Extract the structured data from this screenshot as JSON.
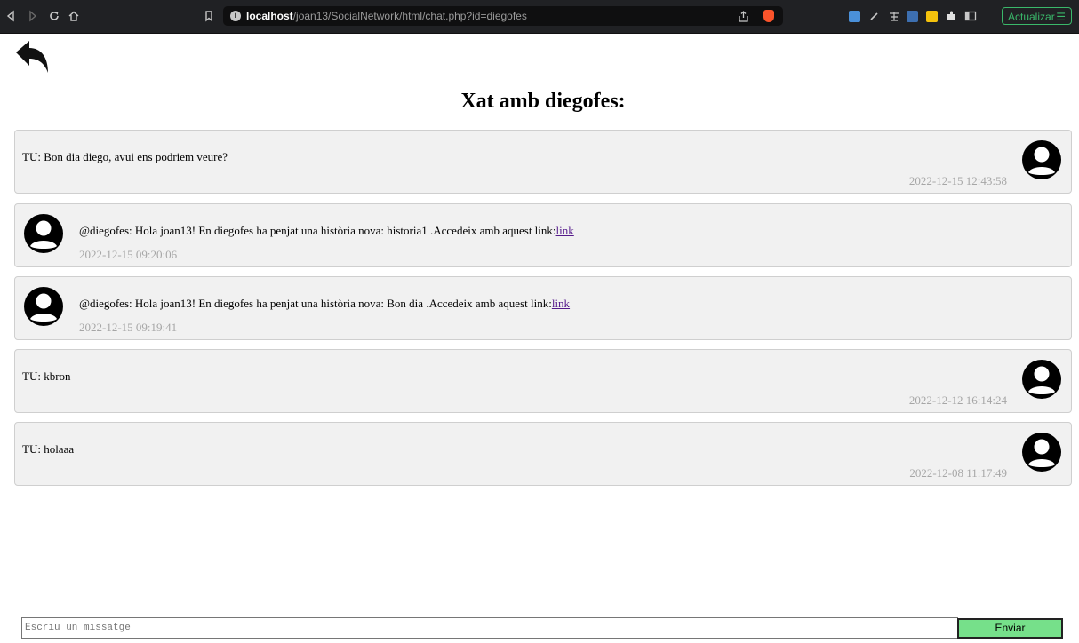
{
  "browser": {
    "url_host": "localhost",
    "url_path": "/joan13/SocialNetwork/html/chat.php?id=diegofes",
    "update_label": "Actualizar"
  },
  "page": {
    "title": "Xat amb diegofes:"
  },
  "messages": [
    {
      "side": "mine",
      "text": "TU: Bon dia diego, avui ens podriem veure?",
      "time": "2022-12-15 12:43:58"
    },
    {
      "side": "theirs",
      "text": "@diegofes: Hola joan13! En diegofes ha penjat una història nova: historia1 .Accedeix amb aquest link:",
      "link": "link",
      "time": "2022-12-15 09:20:06"
    },
    {
      "side": "theirs",
      "text": "@diegofes: Hola joan13! En diegofes ha penjat una història nova: Bon dia .Accedeix amb aquest link:",
      "link": "link",
      "time": "2022-12-15 09:19:41"
    },
    {
      "side": "mine",
      "text": "TU: kbron",
      "time": "2022-12-12 16:14:24"
    },
    {
      "side": "mine",
      "text": "TU: holaaa",
      "time": "2022-12-08 11:17:49"
    }
  ],
  "composer": {
    "placeholder": "Escriu un missatge",
    "send_label": "Enviar"
  }
}
